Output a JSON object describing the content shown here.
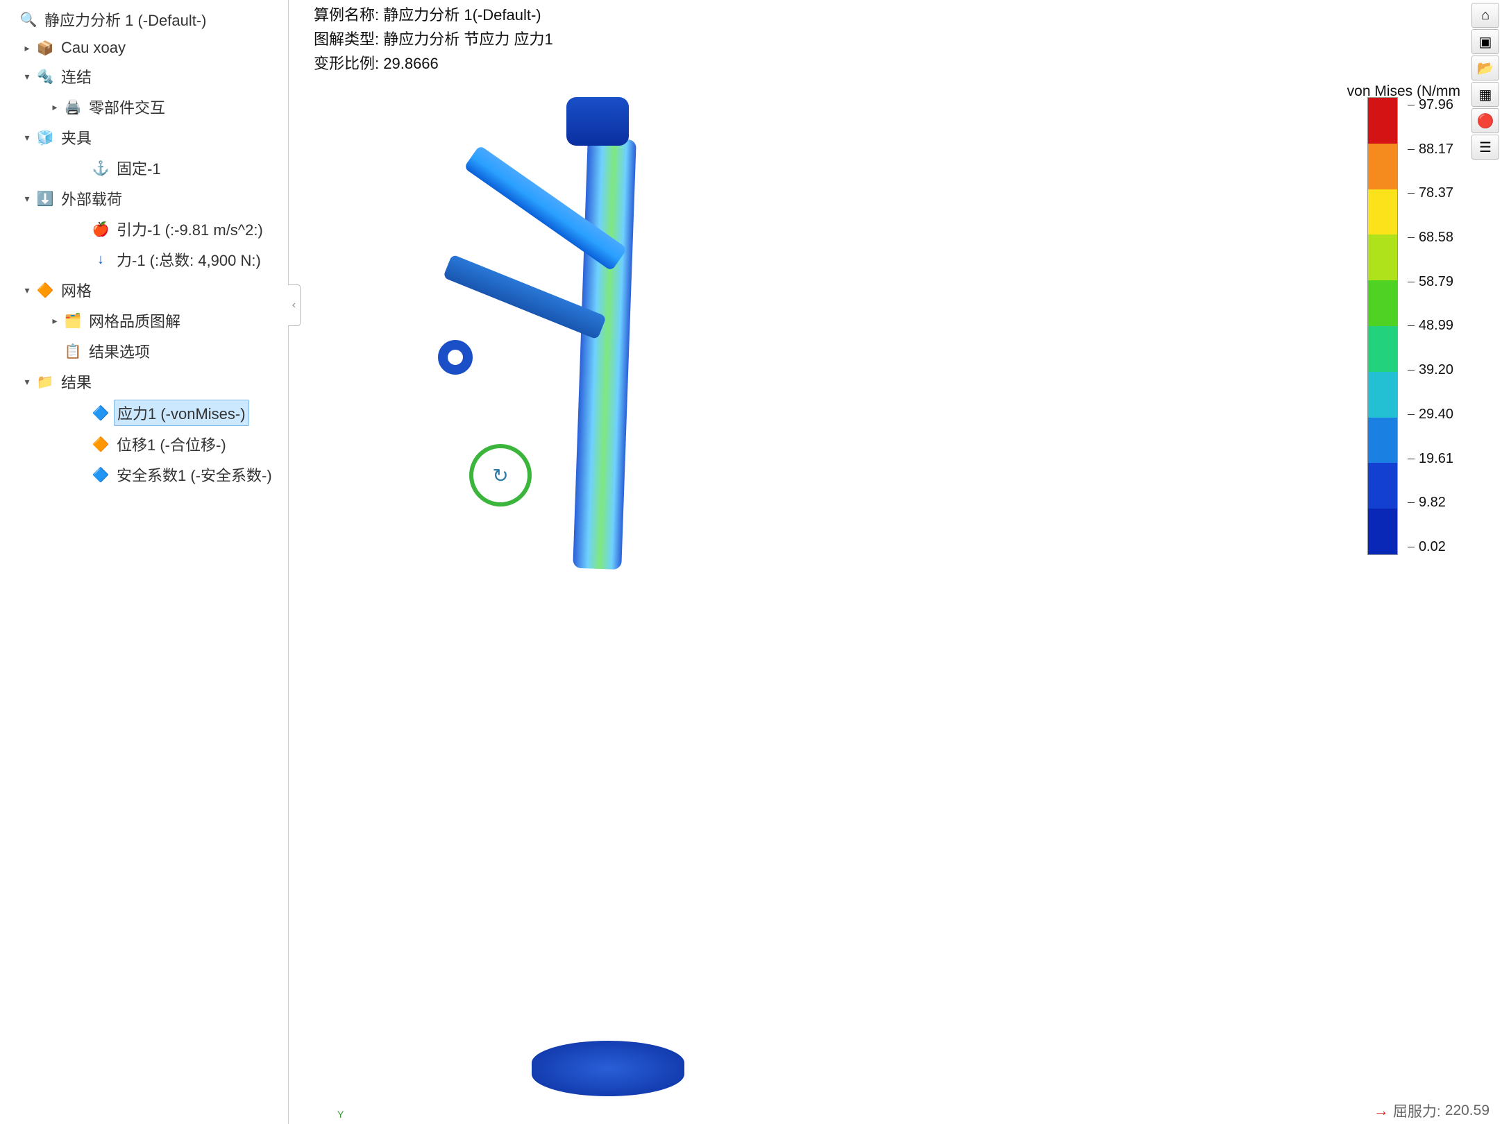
{
  "tree": {
    "study": "静应力分析 1 (-Default-)",
    "part": "Cau xoay",
    "connections": "连结",
    "component_interaction": "零部件交互",
    "fixtures": "夹具",
    "fixture_1": "固定-1",
    "external_loads": "外部载荷",
    "gravity": "引力-1 (:-9.81 m/s^2:)",
    "force": "力-1 (:总数: 4,900 N:)",
    "mesh": "网格",
    "mesh_quality": "网格品质图解",
    "result_options": "结果选项",
    "results": "结果",
    "stress": "应力1 (-vonMises-)",
    "displacement": "位移1 (-合位移-)",
    "factor_of_safety": "安全系数1 (-安全系数-)"
  },
  "viewport": {
    "line1_label": "算例名称:",
    "line1_value": "静应力分析 1(-Default-)",
    "line2_label": "图解类型:",
    "line2_value": "静应力分析 节应力 应力1",
    "line3_label": "变形比例:",
    "line3_value": "29.8666"
  },
  "legend": {
    "title": "von Mises (N/mm",
    "colors": [
      "#d41414",
      "#f58a1f",
      "#fce21a",
      "#b0e21c",
      "#4fd224",
      "#22d27c",
      "#22c0d2",
      "#1a80e2",
      "#1440d2",
      "#0a28b8"
    ],
    "values": [
      "97.96",
      "88.17",
      "78.37",
      "68.58",
      "58.79",
      "48.99",
      "39.20",
      "29.40",
      "19.61",
      "9.82",
      "0.02"
    ]
  },
  "yield": {
    "label": "屈服力:",
    "value": "220.59"
  },
  "side_tools": {
    "home": "home-icon",
    "iso": "iso-view-icon",
    "open": "folder-open-icon",
    "layout": "layout-icon",
    "appearance": "appearance-icon",
    "options": "list-options-icon"
  },
  "axis": {
    "y": "Y"
  }
}
